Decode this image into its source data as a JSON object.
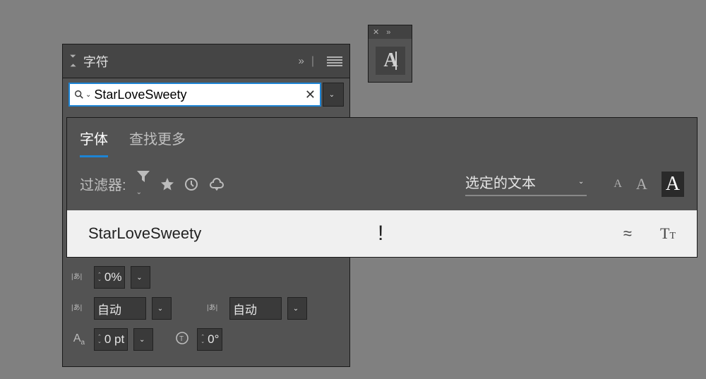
{
  "text_tool": {
    "icon_letter": "A"
  },
  "char_panel": {
    "title": "字符",
    "search_value": "StarLoveSweety",
    "controls": {
      "tracking_percent": "0%",
      "kerning_left": "自动",
      "kerning_right": "自动",
      "baseline_shift": "0 pt",
      "rotation": "0°"
    }
  },
  "font_flyout": {
    "tabs": {
      "fonts": "字体",
      "find_more": "查找更多"
    },
    "filter_label": "过滤器:",
    "preview_label": "选定的文本",
    "size_samples": [
      "A",
      "A",
      "A"
    ],
    "result": {
      "name": "StarLoveSweety",
      "sample": "!"
    }
  }
}
